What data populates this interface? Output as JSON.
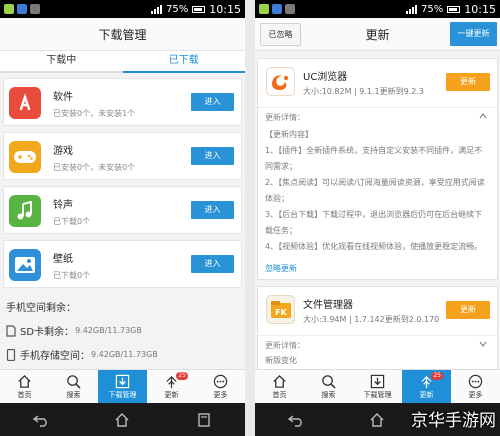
{
  "status_bar": {
    "battery": "75%",
    "time": "10:15"
  },
  "left": {
    "title": "下载管理",
    "tabs": [
      {
        "label": "下载中"
      },
      {
        "label": "已下载"
      }
    ],
    "categories": [
      {
        "name": "软件",
        "sub": "已安装0个，未安装1个",
        "button": "进入",
        "icon": "app-store-icon",
        "color": "#e94b3c"
      },
      {
        "name": "游戏",
        "sub": "已安装0个，未安装0个",
        "button": "进入",
        "icon": "gamepad-icon",
        "color": "#f2a81d"
      },
      {
        "name": "铃声",
        "sub": "已下载0个",
        "button": "进入",
        "icon": "music-note-icon",
        "color": "#57b342"
      },
      {
        "name": "壁纸",
        "sub": "已下载0个",
        "button": "进入",
        "icon": "picture-icon",
        "color": "#2f8fd8"
      }
    ],
    "space": {
      "title": "手机空间剩余：",
      "sd_label": "SD卡剩余：",
      "sd_value": "9.42GB/11.73GB",
      "phone_label": "手机存储空间：",
      "phone_value": "9.42GB/11.73GB"
    }
  },
  "right": {
    "title": "更新",
    "ignored_button": "已忽略",
    "update_all_button": "一键更新",
    "apps": [
      {
        "name": "UC浏览器",
        "meta": "大小:10.82M | 9.1.1更新到9.2.3",
        "button": "更新",
        "icon": "uc-browser-icon",
        "detail_label": "更新详情：",
        "details": [
          "【更新内容】",
          "1、【插件】全新插件系统，支持自定义安装不同插件，满足不同需求；",
          "2、【焦点阅读】可以阅读/订阅海量阅读资源，享受应用式阅读体验；",
          "3、【后台下载】下载过程中，退出浏览器后仍可在后台继续下载任务；",
          "4、【视频体验】优化观看在线视频体验，使播放更稳定流畅。"
        ],
        "ignore": "忽略更新"
      },
      {
        "name": "文件管理器",
        "meta": "大小:3.94M | 1.7.142更新到2.0.170",
        "button": "更新",
        "icon": "file-manager-icon",
        "detail_label": "更新详情：",
        "details": [
          "新版变化"
        ]
      }
    ]
  },
  "bottom_nav": {
    "items": [
      {
        "label": "首页",
        "icon": "home-icon"
      },
      {
        "label": "搜索",
        "icon": "search-icon"
      },
      {
        "label": "下载管理",
        "icon": "download-icon"
      },
      {
        "label": "更新",
        "icon": "update-arrow-icon",
        "badge": "25"
      },
      {
        "label": "更多",
        "icon": "more-icon"
      }
    ]
  },
  "watermark": "京华手游网",
  "colors": {
    "accent": "#1f8fd8",
    "orange": "#f5a11c"
  }
}
